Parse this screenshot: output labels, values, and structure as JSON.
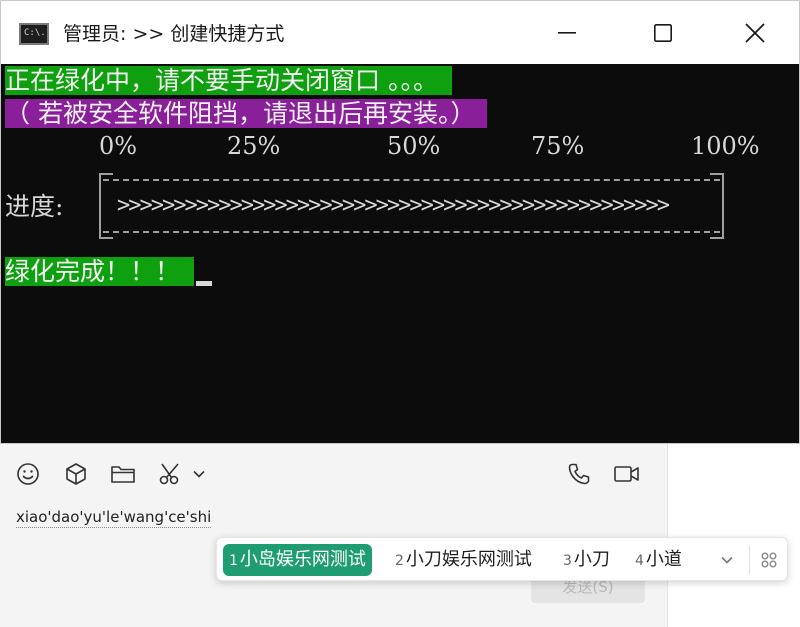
{
  "window": {
    "title": "管理员:  >> 创建快捷方式",
    "icon_text": "C:\\."
  },
  "console": {
    "line1": "正在绿化中，请不要手动关闭窗口 。。。",
    "line2": "（ 若被安全软件阻挡，请退出后再安装。）",
    "percent_labels": [
      "0%",
      "25%",
      "50%",
      "75%",
      "100%"
    ],
    "progress_label": "进度:",
    "progress_bar": ">>>>>>>>>>>>>>>>>>>>>>>>>>>>>>>>>>>>>>>>>>>>>>>>>",
    "progress_fraction": 1.0,
    "done": "绿化完成！！！",
    "colors": {
      "green": "#0fa00f",
      "purple": "#8a1f9a",
      "background": "#0c0c0c"
    }
  },
  "chat": {
    "toolbar": [
      "emoji-icon",
      "cube-icon",
      "folder-icon",
      "scissors-icon",
      "chevron-down-icon",
      "phone-icon",
      "video-icon"
    ],
    "typed_pinyin": "xiao'dao'yu'le'wang'ce'shi",
    "send_label": "发送(S)"
  },
  "ime": {
    "candidates": [
      {
        "num": "1",
        "text": "小岛娱乐网测试",
        "selected": true
      },
      {
        "num": "2",
        "text": "小刀娱乐网测试",
        "selected": false
      },
      {
        "num": "3",
        "text": "小刀",
        "selected": false
      },
      {
        "num": "4",
        "text": "小道",
        "selected": false
      }
    ],
    "accent": "#1f9d72"
  }
}
